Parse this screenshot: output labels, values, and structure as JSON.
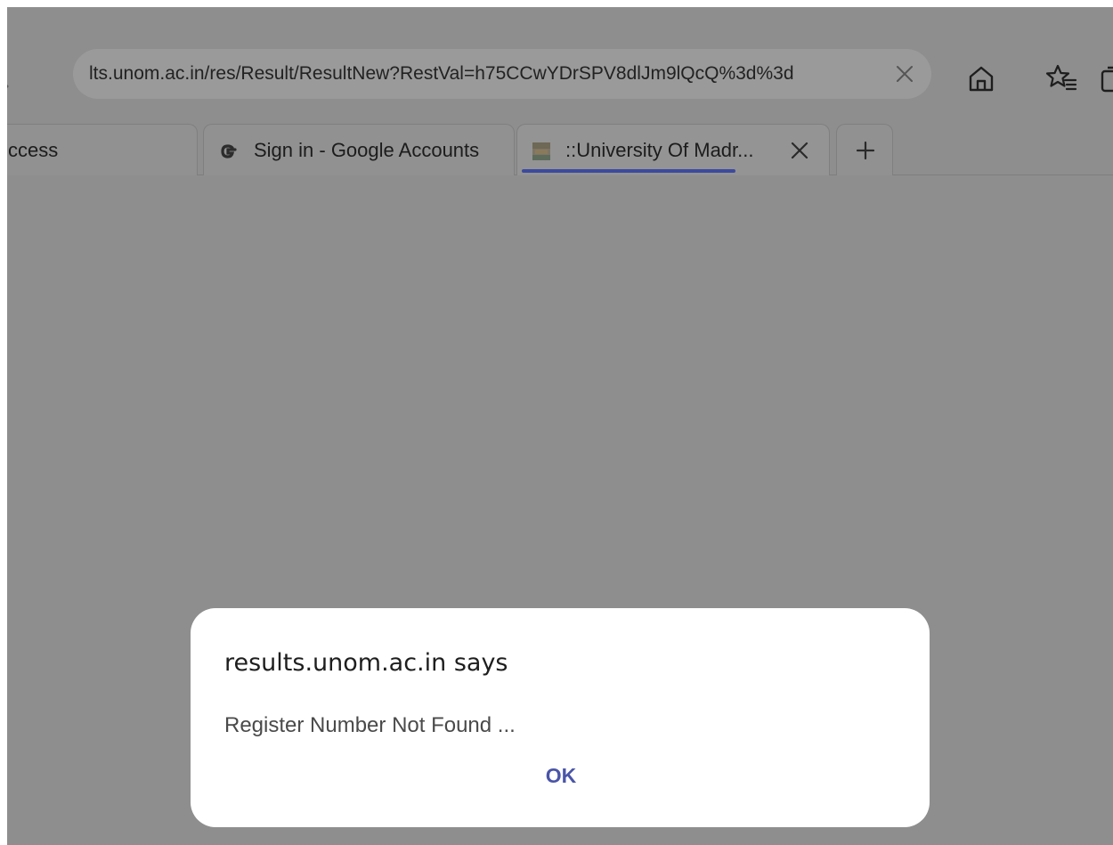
{
  "browser": {
    "address_bar": {
      "url": "lts.unom.ac.in/res/Result/ResultNew?RestVal=h75CCwYDrSPV8dlJm9lQcQ%3d%3d"
    },
    "toolbar_icons": [
      "chevron-right-icon",
      "close-icon",
      "home-icon",
      "favorites-icon",
      "collections-icon"
    ],
    "tabs": [
      {
        "label": "ccess",
        "active": false
      },
      {
        "label": "Sign in - Google Accounts",
        "icon": "google-icon",
        "active": false
      },
      {
        "label": "::University Of Madr...",
        "icon": "university-favicon-icon",
        "active": true
      }
    ],
    "new_tab_icon": "plus-icon"
  },
  "dialog": {
    "title": "results.unom.ac.in says",
    "message": "Register Number Not Found ...",
    "ok_label": "OK"
  },
  "colors": {
    "overlay": "#8e8e8e",
    "dialog_bg": "#ffffff",
    "accent": "#4a55a8",
    "active_tab_indicator": "#3c4a9e"
  }
}
